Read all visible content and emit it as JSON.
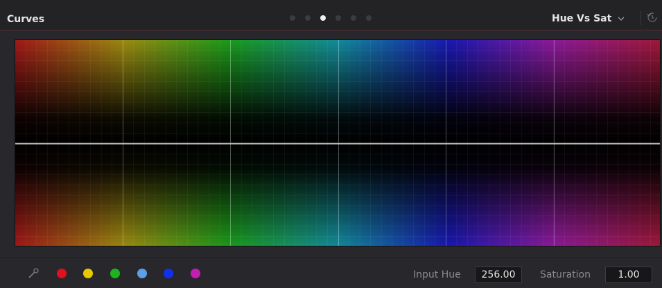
{
  "header": {
    "title": "Curves",
    "mode": "Hue Vs Sat",
    "page_dots": [
      false,
      false,
      true,
      false,
      false,
      false
    ]
  },
  "footer": {
    "swatches": [
      {
        "name": "red",
        "color": "#e01020"
      },
      {
        "name": "yellow",
        "color": "#e8c800"
      },
      {
        "name": "green",
        "color": "#1fb21f"
      },
      {
        "name": "cyan",
        "color": "#5ba0e6"
      },
      {
        "name": "blue",
        "color": "#1030f0"
      },
      {
        "name": "magenta",
        "color": "#c020b0"
      }
    ],
    "input_hue_label": "Input Hue",
    "input_hue_value": "256.00",
    "saturation_label": "Saturation",
    "saturation_value": "1.00"
  },
  "colors": {
    "accent_border": "#5a2a2e",
    "curve_line": "#c8c8c8"
  }
}
